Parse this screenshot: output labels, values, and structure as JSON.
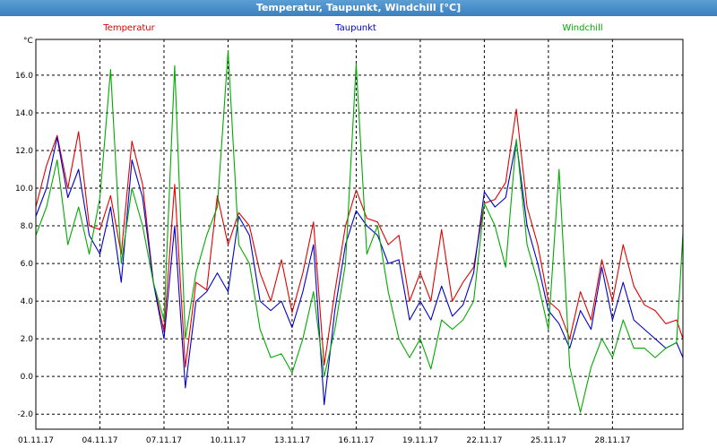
{
  "window": {
    "title": "Temperatur, Taupunkt, Windchill [°C]"
  },
  "chart_data": {
    "type": "line",
    "unit": "°C",
    "ylim": [
      -2.8,
      17.9
    ],
    "yticks": [
      "-2.0",
      "0.0",
      "2.0",
      "4.0",
      "6.0",
      "8.0",
      "10.0",
      "12.0",
      "14.0",
      "16.0"
    ],
    "yticks_values": [
      -2,
      0,
      2,
      4,
      6,
      8,
      10,
      12,
      14,
      16
    ],
    "xlim": [
      1,
      31.3
    ],
    "xticks": [
      "01.11.17",
      "04.11.17",
      "07.11.17",
      "10.11.17",
      "13.11.17",
      "16.11.17",
      "19.11.17",
      "22.11.17",
      "25.11.17",
      "28.11.17"
    ],
    "xticks_values": [
      1,
      4,
      7,
      10,
      13,
      16,
      19,
      22,
      25,
      28
    ],
    "grid": true,
    "legend_placement": "top",
    "x": [
      1.0,
      1.5,
      2.0,
      2.5,
      3.0,
      3.5,
      4.0,
      4.5,
      5.0,
      5.5,
      6.0,
      6.5,
      7.0,
      7.5,
      8.0,
      8.5,
      9.0,
      9.5,
      10.0,
      10.5,
      11.0,
      11.5,
      12.0,
      12.5,
      13.0,
      13.5,
      14.0,
      14.5,
      15.0,
      15.5,
      16.0,
      16.5,
      17.0,
      17.5,
      18.0,
      18.5,
      19.0,
      19.5,
      20.0,
      20.5,
      21.0,
      21.5,
      22.0,
      22.5,
      23.0,
      23.5,
      24.0,
      24.5,
      25.0,
      25.5,
      26.0,
      26.5,
      27.0,
      27.5,
      28.0,
      28.5,
      29.0,
      29.5,
      30.0,
      30.5,
      31.0,
      31.3
    ],
    "series": [
      {
        "name": "Temperatur",
        "color": "#e00000",
        "values": [
          9.0,
          11.2,
          12.8,
          10.0,
          13.0,
          8.0,
          7.8,
          9.6,
          6.5,
          12.5,
          10.2,
          5.0,
          2.4,
          10.2,
          0.5,
          5.0,
          4.6,
          9.6,
          7.0,
          8.7,
          8.0,
          5.5,
          4.0,
          6.2,
          3.4,
          5.5,
          8.2,
          0.6,
          4.5,
          8.0,
          9.9,
          8.4,
          8.2,
          7.0,
          7.5,
          4.0,
          5.5,
          4.0,
          7.8,
          4.0,
          5.0,
          5.8,
          9.2,
          9.4,
          10.3,
          14.2,
          9.0,
          7.0,
          4.0,
          3.5,
          2.0,
          4.5,
          3.0,
          6.2,
          4.0,
          7.0,
          4.8,
          3.8,
          3.5,
          2.8,
          3.0,
          2.0
        ]
      },
      {
        "name": "Taupunkt",
        "color": "#0000cc",
        "values": [
          8.5,
          10.0,
          12.7,
          9.5,
          11.0,
          7.5,
          6.5,
          9.0,
          5.0,
          11.5,
          9.5,
          5.0,
          2.0,
          8.0,
          -0.6,
          4.0,
          4.5,
          5.5,
          4.5,
          8.5,
          7.5,
          4.0,
          3.5,
          4.0,
          2.6,
          4.5,
          7.0,
          -1.5,
          3.5,
          7.0,
          8.8,
          8.0,
          7.5,
          6.0,
          6.2,
          3.0,
          4.0,
          3.0,
          4.8,
          3.2,
          3.8,
          5.5,
          9.8,
          9.0,
          9.5,
          12.5,
          8.0,
          6.0,
          3.5,
          2.8,
          1.5,
          3.5,
          2.5,
          5.8,
          3.0,
          5.0,
          3.0,
          2.5,
          2.0,
          1.5,
          1.8,
          1.0
        ]
      },
      {
        "name": "Windchill",
        "color": "#00aa00",
        "values": [
          7.5,
          9.0,
          11.5,
          7.0,
          9.0,
          6.5,
          9.5,
          16.3,
          6.0,
          10.0,
          8.0,
          5.0,
          3.0,
          16.5,
          2.0,
          5.5,
          7.5,
          9.0,
          17.3,
          7.0,
          6.0,
          2.5,
          1.0,
          1.2,
          0.2,
          2.0,
          4.5,
          0.0,
          2.5,
          6.0,
          16.6,
          6.5,
          8.0,
          4.5,
          2.0,
          1.0,
          2.0,
          0.4,
          3.0,
          2.5,
          3.0,
          4.0,
          9.2,
          8.0,
          5.8,
          12.6,
          7.0,
          5.0,
          2.5,
          11.0,
          0.5,
          -1.9,
          0.5,
          2.0,
          1.0,
          3.0,
          1.5,
          1.5,
          1.0,
          1.5,
          1.8,
          7.6
        ]
      }
    ]
  }
}
